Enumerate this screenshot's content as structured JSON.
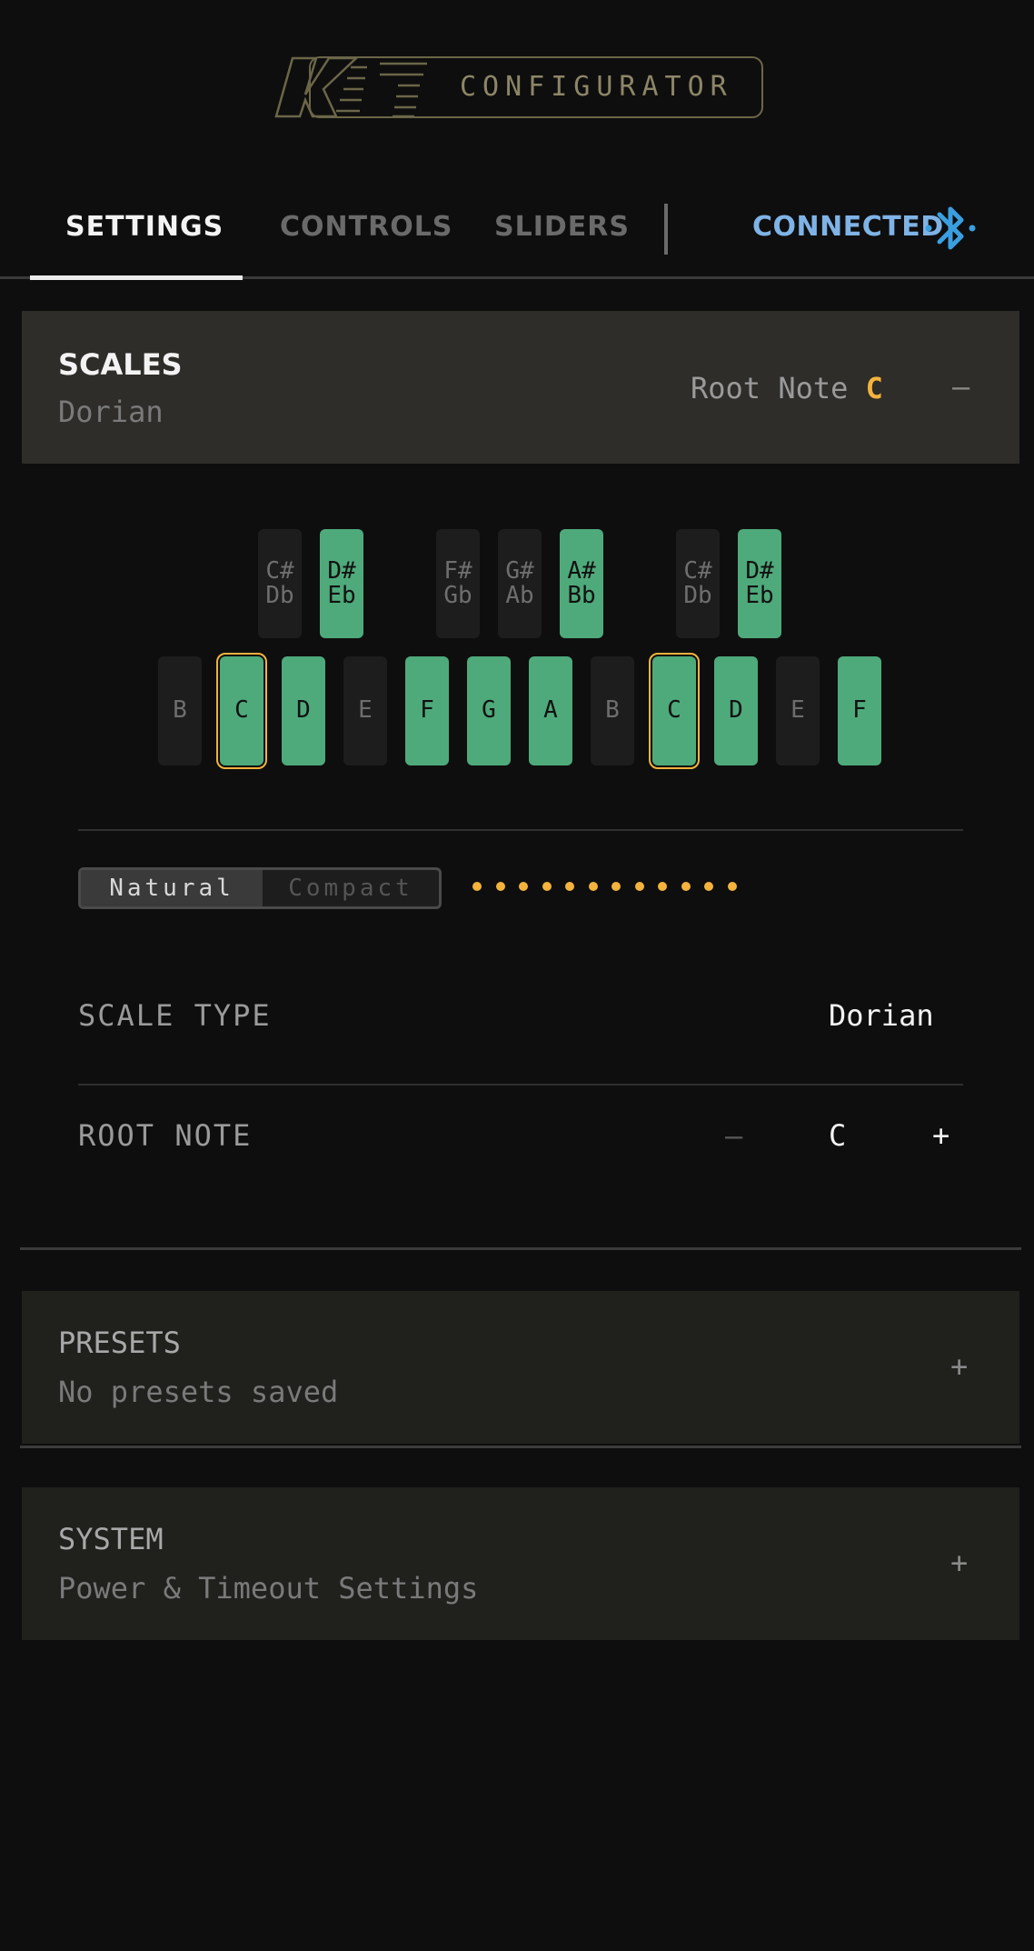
{
  "header": {
    "logo_text": "CONFIGURATOR"
  },
  "tabs": [
    {
      "label": "SETTINGS",
      "active": true
    },
    {
      "label": "CONTROLS",
      "active": false
    },
    {
      "label": "SLIDERS",
      "active": false
    }
  ],
  "connection": {
    "status": "CONNECTED",
    "icon": "bluetooth-icon",
    "color": "#7fb3e6"
  },
  "scales": {
    "title": "SCALES",
    "subtitle": "Dorian",
    "root_label": "Root Note",
    "root_value": "C",
    "collapse": "–"
  },
  "keyboard": {
    "black_keys": [
      {
        "top": "C#",
        "bottom": "Db",
        "on": false
      },
      {
        "top": "D#",
        "bottom": "Eb",
        "on": true
      },
      {
        "top": "F#",
        "bottom": "Gb",
        "on": false
      },
      {
        "top": "G#",
        "bottom": "Ab",
        "on": false
      },
      {
        "top": "A#",
        "bottom": "Bb",
        "on": true
      },
      {
        "top": "C#",
        "bottom": "Db",
        "on": false
      },
      {
        "top": "D#",
        "bottom": "Eb",
        "on": true
      }
    ],
    "white_keys": [
      {
        "label": "B",
        "on": false,
        "root": false
      },
      {
        "label": "C",
        "on": true,
        "root": true
      },
      {
        "label": "D",
        "on": true,
        "root": false
      },
      {
        "label": "E",
        "on": false,
        "root": false
      },
      {
        "label": "F",
        "on": true,
        "root": false
      },
      {
        "label": "G",
        "on": true,
        "root": false
      },
      {
        "label": "A",
        "on": true,
        "root": false
      },
      {
        "label": "B",
        "on": false,
        "root": false
      },
      {
        "label": "C",
        "on": true,
        "root": true
      },
      {
        "label": "D",
        "on": true,
        "root": false
      },
      {
        "label": "E",
        "on": false,
        "root": false
      },
      {
        "label": "F",
        "on": true,
        "root": false
      }
    ]
  },
  "layout_toggle": {
    "options": [
      "Natural",
      "Compact"
    ],
    "selected": "Natural",
    "dot_count": 12
  },
  "scale_type": {
    "label": "SCALE TYPE",
    "value": "Dorian"
  },
  "root_note": {
    "label": "ROOT NOTE",
    "minus": "–",
    "value": "C",
    "plus": "+"
  },
  "presets": {
    "title": "PRESETS",
    "subtitle": "No presets saved",
    "expand": "+"
  },
  "system": {
    "title": "SYSTEM",
    "subtitle": "Power & Timeout Settings",
    "expand": "+"
  },
  "colors": {
    "accent": "#f3b33d",
    "key_on": "#4eaa7a",
    "key_off": "#1d1d1d",
    "connected": "#7fb3e6"
  }
}
